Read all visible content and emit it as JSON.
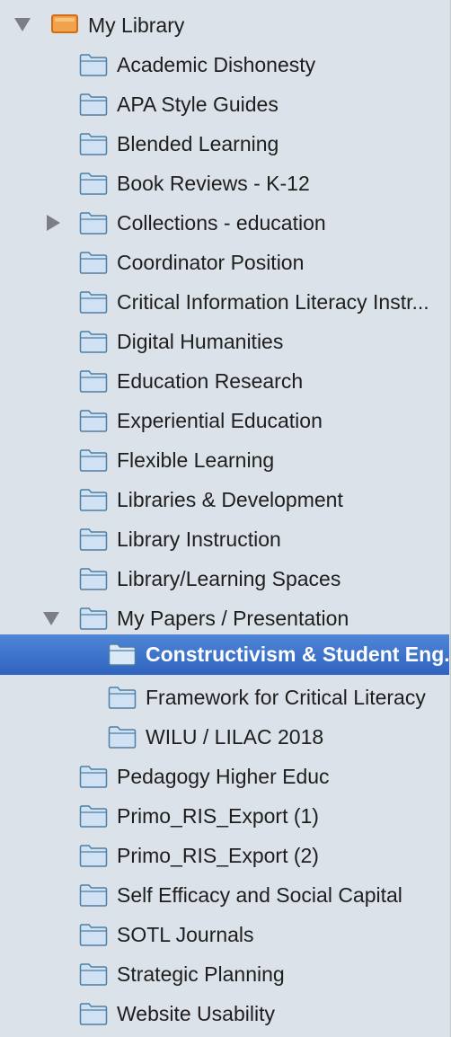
{
  "library": {
    "label": "My Library",
    "expanded": true,
    "icon": "library-icon"
  },
  "collections": [
    {
      "label": "Academic Dishonesty",
      "level": 1
    },
    {
      "label": "APA Style Guides",
      "level": 1
    },
    {
      "label": "Blended Learning",
      "level": 1
    },
    {
      "label": "Book Reviews - K-12",
      "level": 1
    },
    {
      "label": "Collections - education",
      "level": 1,
      "disclosure": "collapsed"
    },
    {
      "label": "Coordinator Position",
      "level": 1
    },
    {
      "label": "Critical Information Literacy Instr...",
      "level": 1
    },
    {
      "label": "Digital Humanities",
      "level": 1
    },
    {
      "label": "Education Research",
      "level": 1
    },
    {
      "label": "Experiential Education",
      "level": 1
    },
    {
      "label": "Flexible Learning",
      "level": 1
    },
    {
      "label": "Libraries & Development",
      "level": 1
    },
    {
      "label": "Library Instruction",
      "level": 1
    },
    {
      "label": "Library/Learning Spaces",
      "level": 1
    },
    {
      "label": "My Papers / Presentation",
      "level": 1,
      "disclosure": "expanded"
    },
    {
      "label": "Constructivism & Student Eng...",
      "level": 2,
      "selected": true
    },
    {
      "label": "Framework for Critical Literacy",
      "level": 2
    },
    {
      "label": "WILU / LILAC 2018",
      "level": 2
    },
    {
      "label": "Pedagogy Higher Educ",
      "level": 1
    },
    {
      "label": "Primo_RIS_Export (1)",
      "level": 1
    },
    {
      "label": "Primo_RIS_Export (2)",
      "level": 1
    },
    {
      "label": "Self Efficacy and Social Capital",
      "level": 1
    },
    {
      "label": "SOTL Journals",
      "level": 1
    },
    {
      "label": "Strategic Planning",
      "level": 1
    },
    {
      "label": "Website Usability",
      "level": 1
    }
  ],
  "colors": {
    "background": "#dce2e9",
    "selection": "#3a6fc8",
    "folder": "#cfe1f2",
    "folder_outline": "#4d7fa6",
    "library_icon": "#e08a2c"
  }
}
